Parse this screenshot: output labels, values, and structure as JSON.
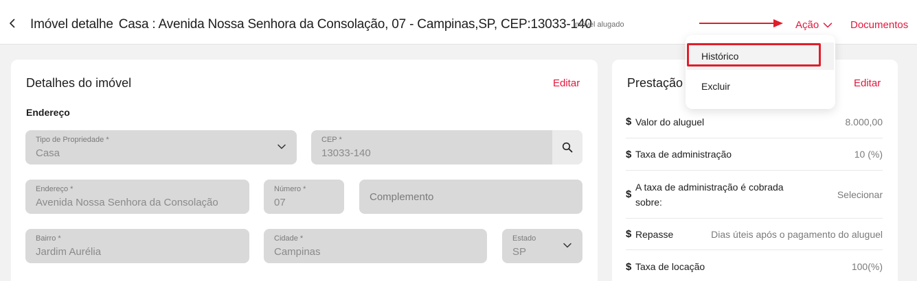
{
  "header": {
    "title_label": "Imóvel detalhe",
    "title_property": "Casa : Avenida Nossa Senhora da Consolação, 07 - Campinas,SP, CEP:13033-140",
    "status": "Imóvel alugado",
    "action_label": "Ação",
    "documents_label": "Documentos"
  },
  "action_menu": {
    "items": [
      "Histórico",
      "Excluir"
    ]
  },
  "details": {
    "title": "Detalhes do imóvel",
    "edit_label": "Editar",
    "address_heading": "Endereço",
    "fields": {
      "property_type": {
        "label": "Tipo de Propriedade *",
        "value": "Casa"
      },
      "cep": {
        "label": "CEP *",
        "value": "13033-140"
      },
      "address": {
        "label": "Endereço *",
        "value": "Avenida Nossa Senhora da Consolação"
      },
      "number": {
        "label": "Número *",
        "value": "07"
      },
      "complement": {
        "placeholder": "Complemento"
      },
      "neighborhood": {
        "label": "Bairro *",
        "value": "Jardim Aurélia"
      },
      "city": {
        "label": "Cidade *",
        "value": "Campinas"
      },
      "state": {
        "label": "Estado",
        "value": "SP"
      }
    }
  },
  "services": {
    "title": "Prestação",
    "edit_label": "Editar",
    "rows": [
      {
        "label": "Valor do aluguel",
        "value": "8.000,00"
      },
      {
        "label": "Taxa de administração",
        "value": "10 (%)"
      },
      {
        "label": "A taxa de administração é cobrada sobre:",
        "value": "Selecionar"
      },
      {
        "label": "Repasse",
        "value": "Dias úteis após o pagamento do aluguel"
      },
      {
        "label": "Taxa de locação",
        "value": "100(%)"
      }
    ],
    "currency_symbol": "$"
  },
  "colors": {
    "accent": "#e4163c",
    "annotation": "#e01e2a",
    "field_bg": "#d9d9d9"
  }
}
